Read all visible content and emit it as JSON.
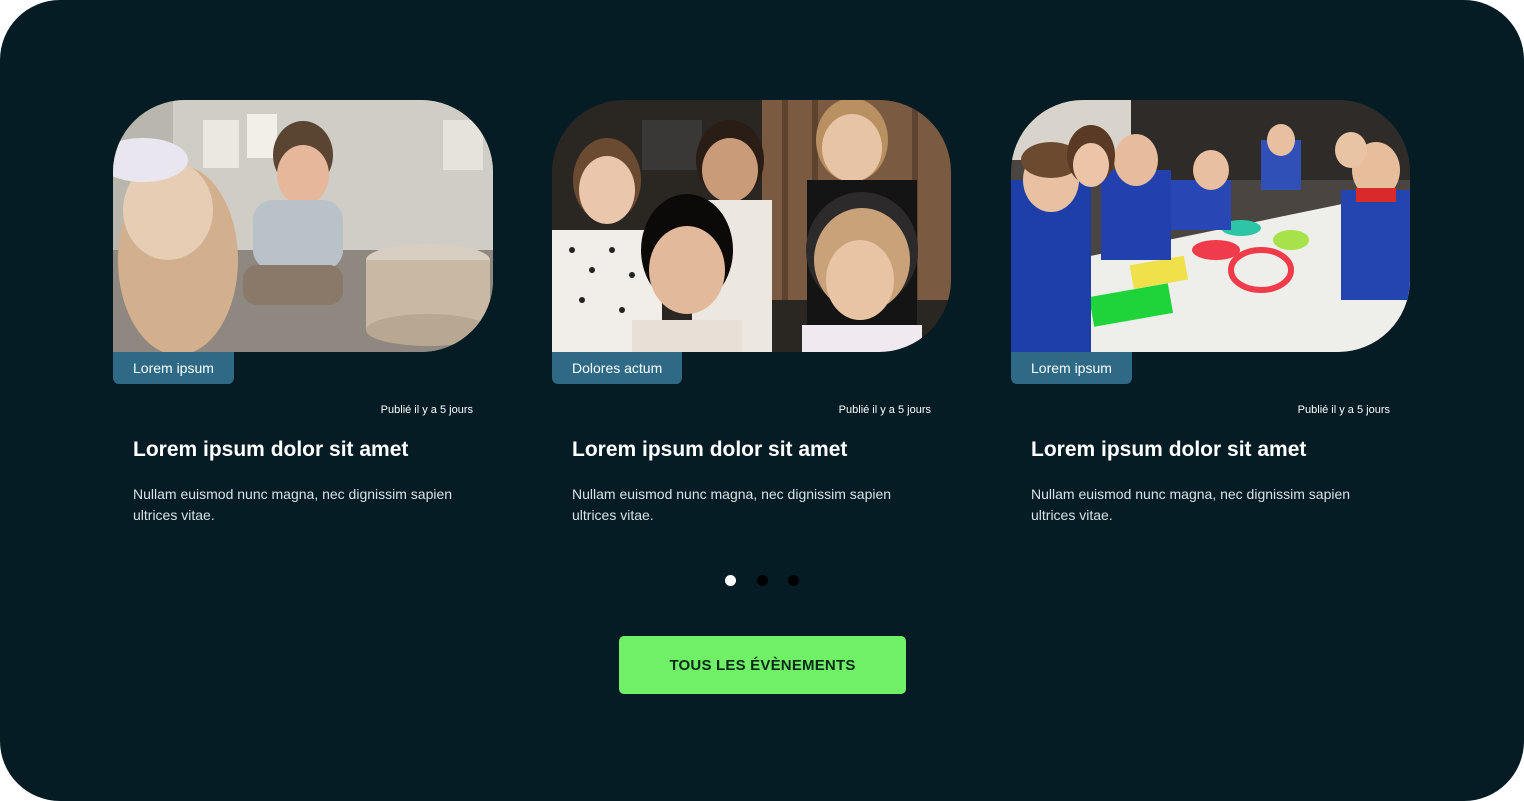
{
  "colors": {
    "background": "#051c25",
    "tag": "#2e6a86",
    "cta": "#70f067",
    "dot_active": "#ffffff",
    "dot_inactive": "#000000"
  },
  "cards": [
    {
      "image": "children-pottery-workshop-photo",
      "tag": "Lorem ipsum",
      "date": "Publié il y a 5 jours",
      "title": "Lorem ipsum dolor sit amet",
      "description": "Nullam euismod nunc magna, nec dignissim sapien ultrices vitae."
    },
    {
      "image": "children-with-headphones-studio-photo",
      "tag": "Dolores actum",
      "date": "Publié il y a 5 jours",
      "title": "Lorem ipsum dolor sit amet",
      "description": "Nullam euismod nunc magna, nec dignissim sapien ultrices vitae."
    },
    {
      "image": "children-painting-banner-photo",
      "tag": "Lorem ipsum",
      "date": "Publié il y a 5 jours",
      "title": "Lorem ipsum dolor sit amet",
      "description": "Nullam euismod nunc magna, nec dignissim sapien ultrices vitae."
    }
  ],
  "pagination": {
    "count": 3,
    "active_index": 0
  },
  "cta": {
    "label": "TOUS LES ÉVÈNEMENTS"
  }
}
